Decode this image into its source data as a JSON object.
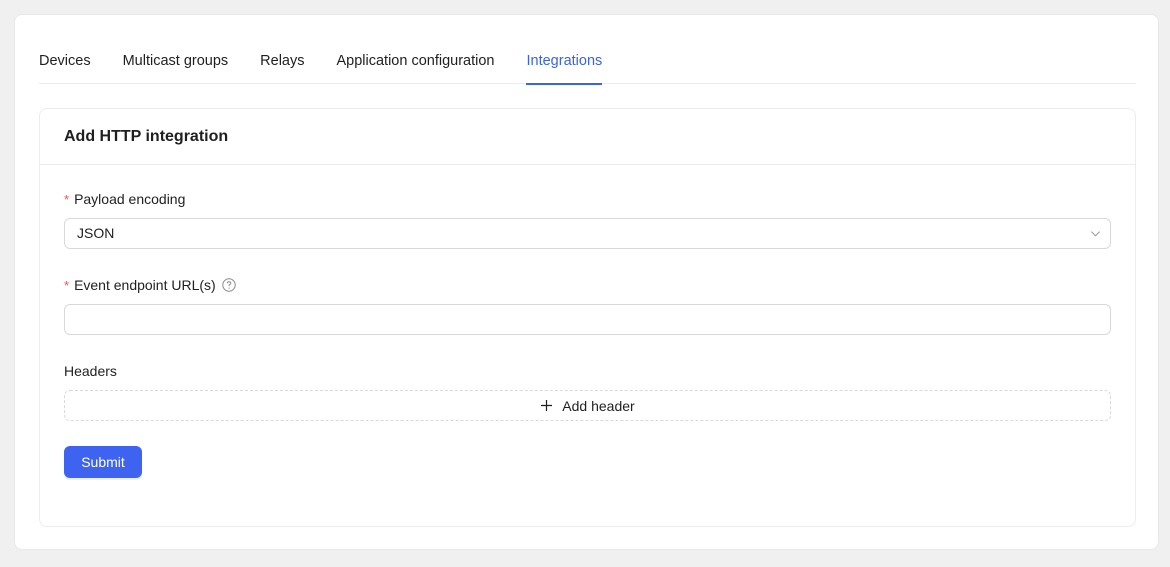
{
  "tabs": [
    {
      "label": "Devices",
      "active": false
    },
    {
      "label": "Multicast groups",
      "active": false
    },
    {
      "label": "Relays",
      "active": false
    },
    {
      "label": "Application configuration",
      "active": false
    },
    {
      "label": "Integrations",
      "active": true
    }
  ],
  "card": {
    "title": "Add HTTP integration"
  },
  "form": {
    "payload_encoding": {
      "label": "Payload encoding",
      "required_mark": "*",
      "value": "JSON"
    },
    "event_endpoint": {
      "label": "Event endpoint URL(s)",
      "required_mark": "*",
      "value": "",
      "placeholder": ""
    },
    "headers": {
      "label": "Headers",
      "add_label": "Add header"
    },
    "submit_label": "Submit"
  },
  "colors": {
    "accent": "#3b63e6",
    "primary_button": "#3d63f0",
    "required": "#ff4d4f"
  },
  "icons": {
    "select_arrow": "chevron-down-icon",
    "help": "question-circle-icon",
    "add": "plus-icon"
  }
}
